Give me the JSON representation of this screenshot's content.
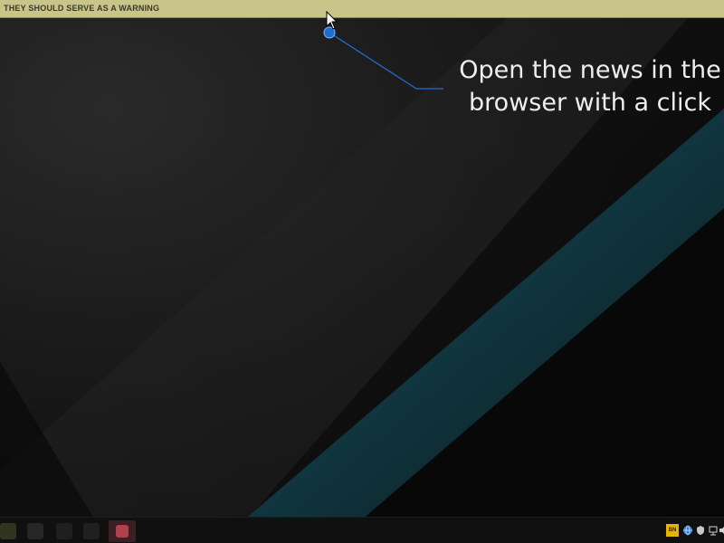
{
  "ticker": {
    "headline": "THEY SHOULD SERVE AS A WARNING",
    "background": "#c9c48a"
  },
  "annotation": {
    "line1": "Open the news in the",
    "line2": "browser with a click",
    "accent": "#1e6fd0"
  },
  "taskbar": {
    "apps": [
      "app-icon",
      "app-icon",
      "app-icon",
      "app-icon",
      "active-app-icon"
    ],
    "tray": {
      "news_badge": "BN",
      "icons": [
        "news-tray-icon",
        "globe-icon",
        "shield-icon",
        "network-icon",
        "volume-icon"
      ]
    }
  }
}
